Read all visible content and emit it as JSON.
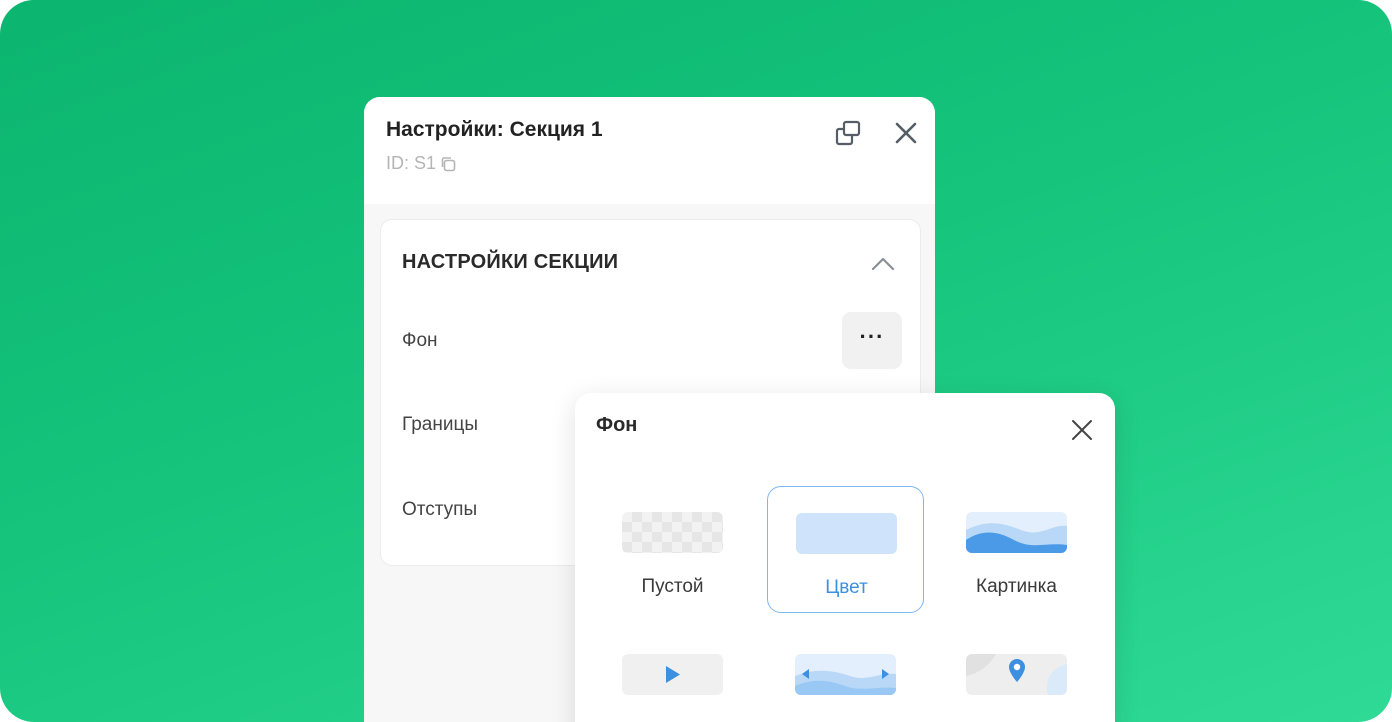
{
  "settings_panel": {
    "title": "Настройки: Секция 1",
    "id_label": "ID: S1",
    "section": {
      "title": "НАСТРОЙКИ СЕКЦИИ",
      "rows": [
        {
          "label": "Фон",
          "action": "···"
        },
        {
          "label": "Границы"
        },
        {
          "label": "Отступы"
        }
      ]
    }
  },
  "background_popup": {
    "title": "Фон",
    "options": [
      {
        "label": "Пустой",
        "icon": "transparent-checker-icon"
      },
      {
        "label": "Цвет",
        "icon": "solid-color-icon",
        "selected": true
      },
      {
        "label": "Картинка",
        "icon": "image-waves-icon"
      },
      {
        "icon": "video-play-icon"
      },
      {
        "icon": "slider-arrows-icon"
      },
      {
        "icon": "map-pin-icon"
      }
    ]
  },
  "colors": {
    "background_gradient_start": "#0bb56f",
    "background_gradient_end": "#2fda97",
    "accent_blue": "#3d8fe0",
    "selected_border": "#7db8f0",
    "color_swatch": "#cfe4fb"
  }
}
